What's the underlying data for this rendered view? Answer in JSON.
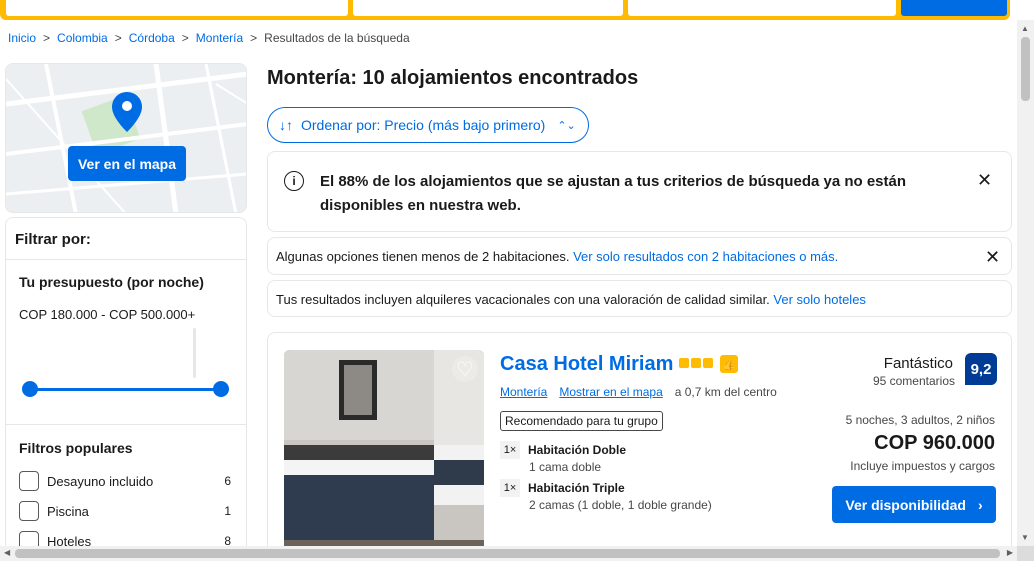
{
  "breadcrumb": {
    "items": [
      "Inicio",
      "Colombia",
      "Córdoba",
      "Montería"
    ],
    "current": "Resultados de la búsqueda"
  },
  "map": {
    "button": "Ver en el mapa"
  },
  "filters": {
    "title": "Filtrar por:",
    "budget_title": "Tu presupuesto (por noche)",
    "budget_range": "COP 180.000 - COP 500.000+",
    "popular_title": "Filtros populares",
    "popular": [
      {
        "label": "Desayuno incluido",
        "count": "6"
      },
      {
        "label": "Piscina",
        "count": "1"
      },
      {
        "label": "Hoteles",
        "count": "8"
      }
    ]
  },
  "results": {
    "title": "Montería: 10 alojamientos encontrados",
    "sort_label": "Ordenar por: Precio (más bajo primero)"
  },
  "notices": {
    "availability": "El 88% de los alojamientos que se ajustan a tus criterios de búsqueda ya no están disponibles en nuestra web.",
    "rooms_text": "Algunas opciones tienen menos de 2 habitaciones.",
    "rooms_link": "Ver solo resultados con 2 habitaciones o más.",
    "vacation_text": "Tus resultados incluyen alquileres vacacionales con una valoración de calidad similar.",
    "vacation_link": "Ver solo hoteles"
  },
  "hotel": {
    "name": "Casa Hotel Miriam",
    "location_link": "Montería",
    "map_link": "Mostrar en el mapa",
    "distance": "a 0,7 km del centro",
    "badge": "Recomendado para tu grupo",
    "rooms": [
      {
        "qty": "1×",
        "type": "Habitación Doble",
        "beds": "1 cama doble"
      },
      {
        "qty": "1×",
        "type": "Habitación Triple",
        "beds": "2 camas (1 doble, 1 doble grande)"
      }
    ],
    "rating_word": "Fantástico",
    "rating_count": "95 comentarios",
    "score": "9,2",
    "stay": "5 noches, 3 adultos, 2 niños",
    "price": "COP 960.000",
    "tax": "Incluye impuestos y cargos",
    "button": "Ver disponibilidad"
  },
  "colors": {
    "brand_blue": "#006ce4",
    "brand_yellow": "#febb02",
    "score_blue": "#003b95"
  }
}
